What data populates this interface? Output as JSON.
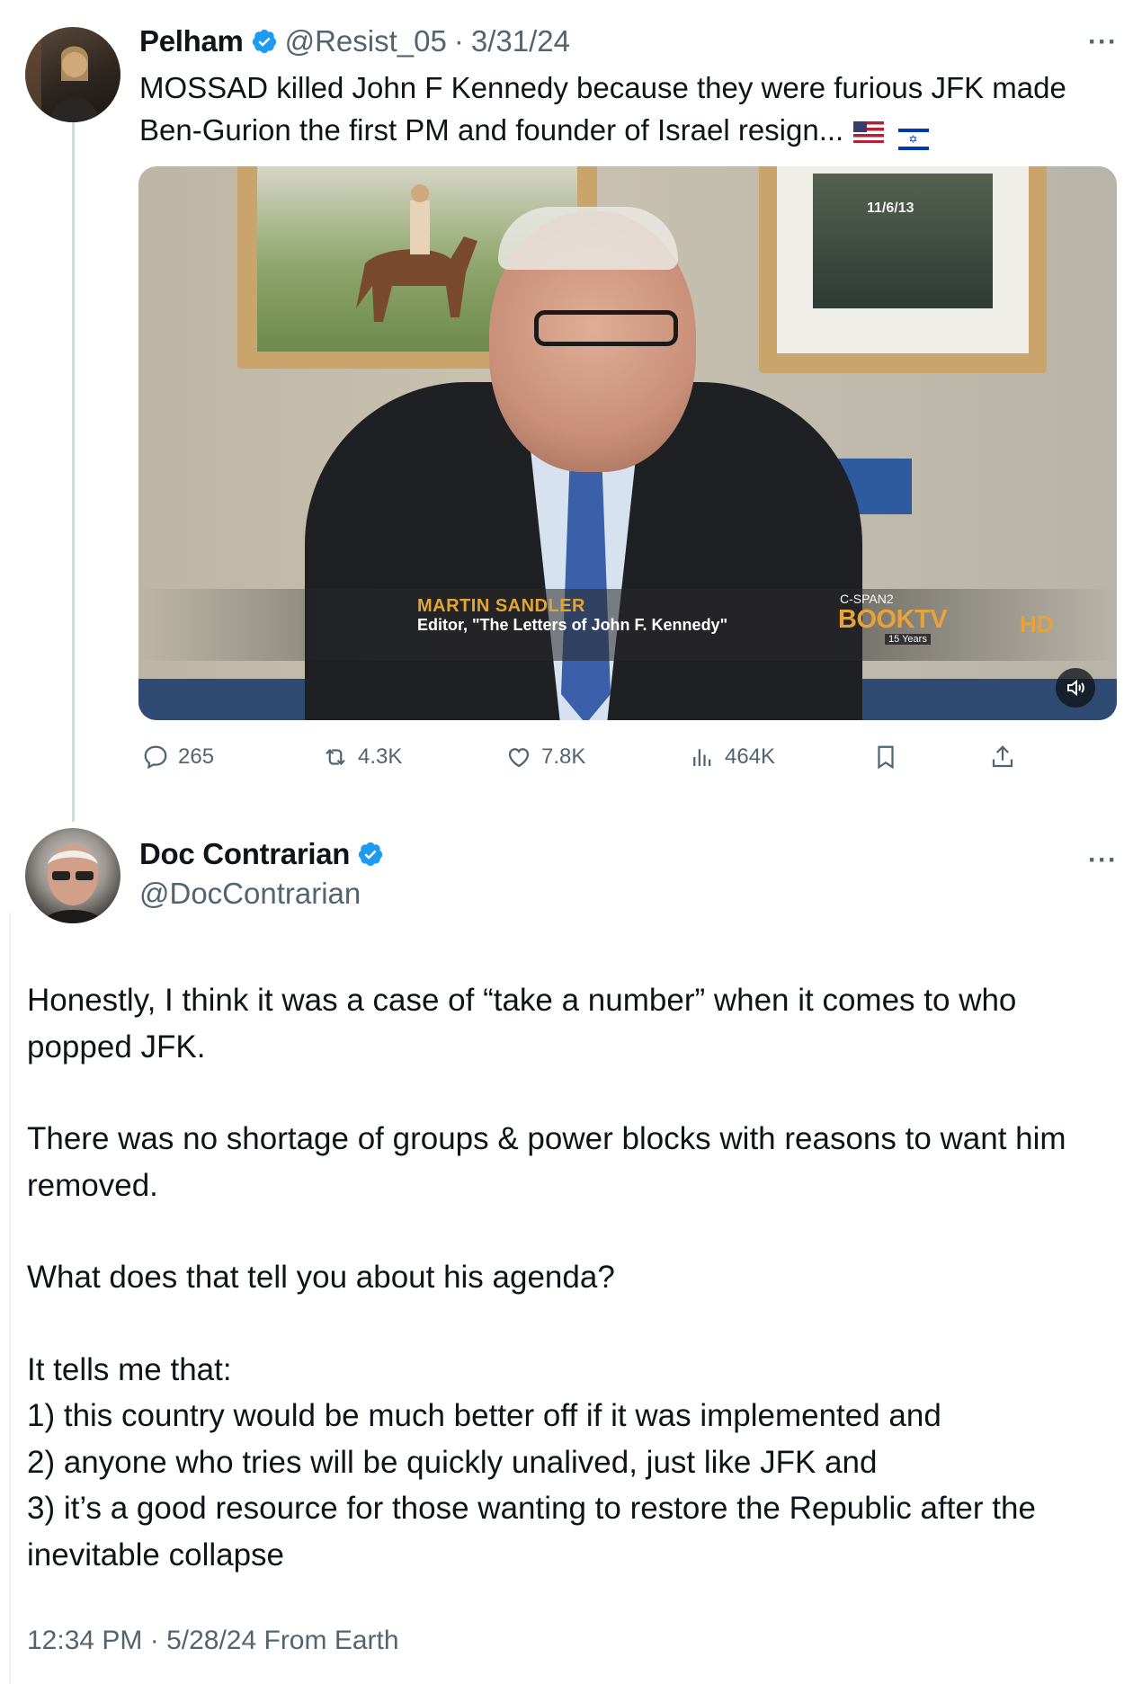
{
  "tweet1": {
    "author_name": "Pelham",
    "handle": "@Resist_05",
    "separator": "·",
    "date": "3/31/24",
    "more": "···",
    "text": "MOSSAD killed John F Kennedy because they were furious JFK made Ben-Gurion the first PM and founder of Israel resign...",
    "video": {
      "date_stamp": "11/6/13",
      "lower_third_name": "MARTIN SANDLER",
      "lower_third_title": "Editor, \"The Letters of John F. Kennedy\"",
      "network": "C-SPAN2",
      "show": "BOOKTV",
      "badge": "15 Years",
      "quality": "HD"
    },
    "stats": {
      "replies": "265",
      "reposts": "4.3K",
      "likes": "7.8K",
      "views": "464K"
    }
  },
  "tweet2": {
    "author_name": "Doc Contrarian",
    "handle": "@DocContrarian",
    "more": "···",
    "paragraphs": [
      "Honestly, I think it was a case of “take a number” when it comes to who popped JFK.",
      "There was no shortage of groups & power blocks with reasons to want him removed.",
      "What does that tell you about his agenda?"
    ],
    "list_intro": "It tells me that:",
    "list_items": [
      "1) this country would be much better off if it was implemented and",
      "2) anyone who tries will be quickly unalived, just like JFK and",
      "3) it’s a good resource for those wanting to restore the Republic after the inevitable collapse"
    ],
    "footer": "12:34 PM · 5/28/24 From Earth"
  },
  "colors": {
    "verified": "#1d9bf0",
    "secondary_text": "#536471",
    "thread_line": "#cfd9de"
  }
}
